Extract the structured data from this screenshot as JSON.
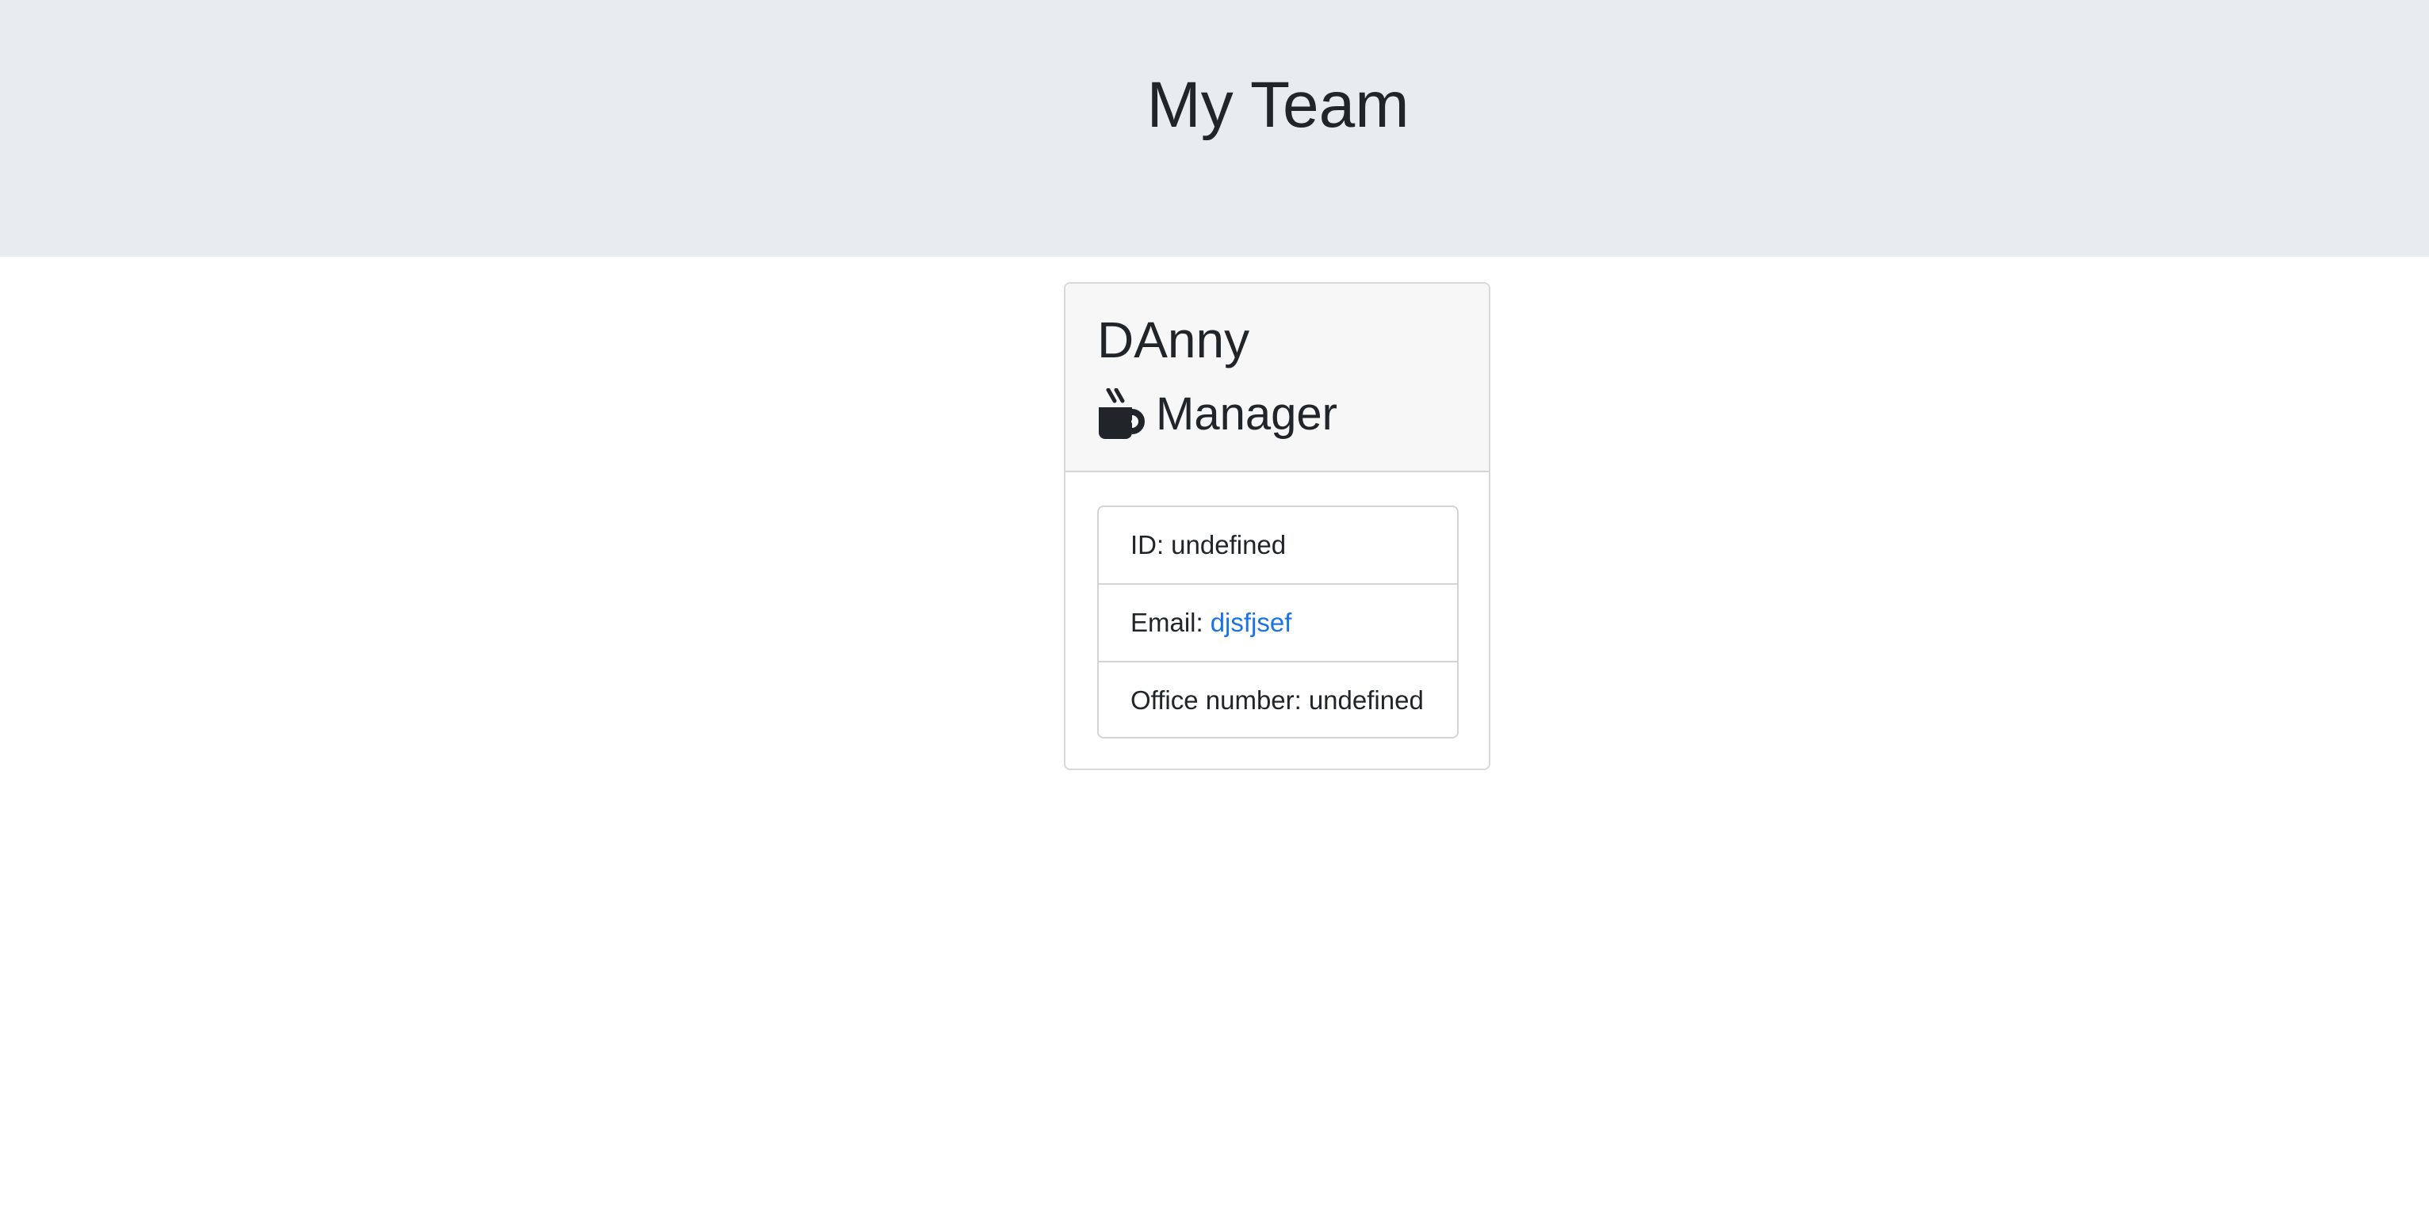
{
  "header": {
    "title": "My Team"
  },
  "card": {
    "name": "DAnny",
    "role": {
      "icon": "mug-hot-icon",
      "label": "Manager"
    },
    "details": {
      "id_label": "ID:",
      "id_value": "undefined",
      "email_label": "Email:",
      "email_value": "djsfjsef",
      "office_label": "Office number:",
      "office_value": "undefined"
    }
  },
  "colors": {
    "jumbotron_bg": "#e9ecef",
    "card_header_bg": "#f7f7f7",
    "link": "#1a73e8",
    "text": "#212529"
  }
}
